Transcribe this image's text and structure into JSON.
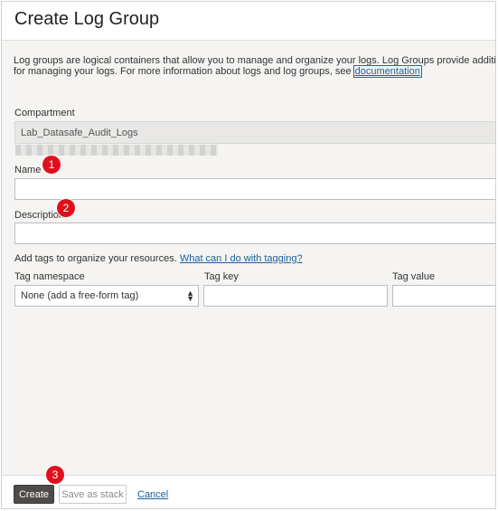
{
  "page": {
    "title": "Create Log Group",
    "intro_text": "Log groups are logical containers that allow you to manage and organize your logs. Log Groups provide additional flexibility for managing your logs. For more information about logs and log groups, see",
    "intro_link": "documentation"
  },
  "form": {
    "compartment_label": "Compartment",
    "compartment_value": "Lab_Datasafe_Audit_Logs",
    "name_label": "Name",
    "name_value": "",
    "description_label": "Description",
    "description_value": "",
    "tags_text": "Add tags to organize your resources.",
    "tags_link": "What can I do with tagging?",
    "tag_namespace_label": "Tag namespace",
    "tag_namespace_value": "None (add a free-form tag)",
    "tag_key_label": "Tag key",
    "tag_value_label": "Tag value"
  },
  "annotations": [
    "1",
    "2",
    "3"
  ],
  "footer": {
    "create_label": "Create",
    "save_stack_label": "Save as stack",
    "cancel_label": "Cancel"
  },
  "colors": {
    "primary_button": "#4f4b48",
    "link": "#1a5ea1",
    "badge": "#e0101b"
  }
}
